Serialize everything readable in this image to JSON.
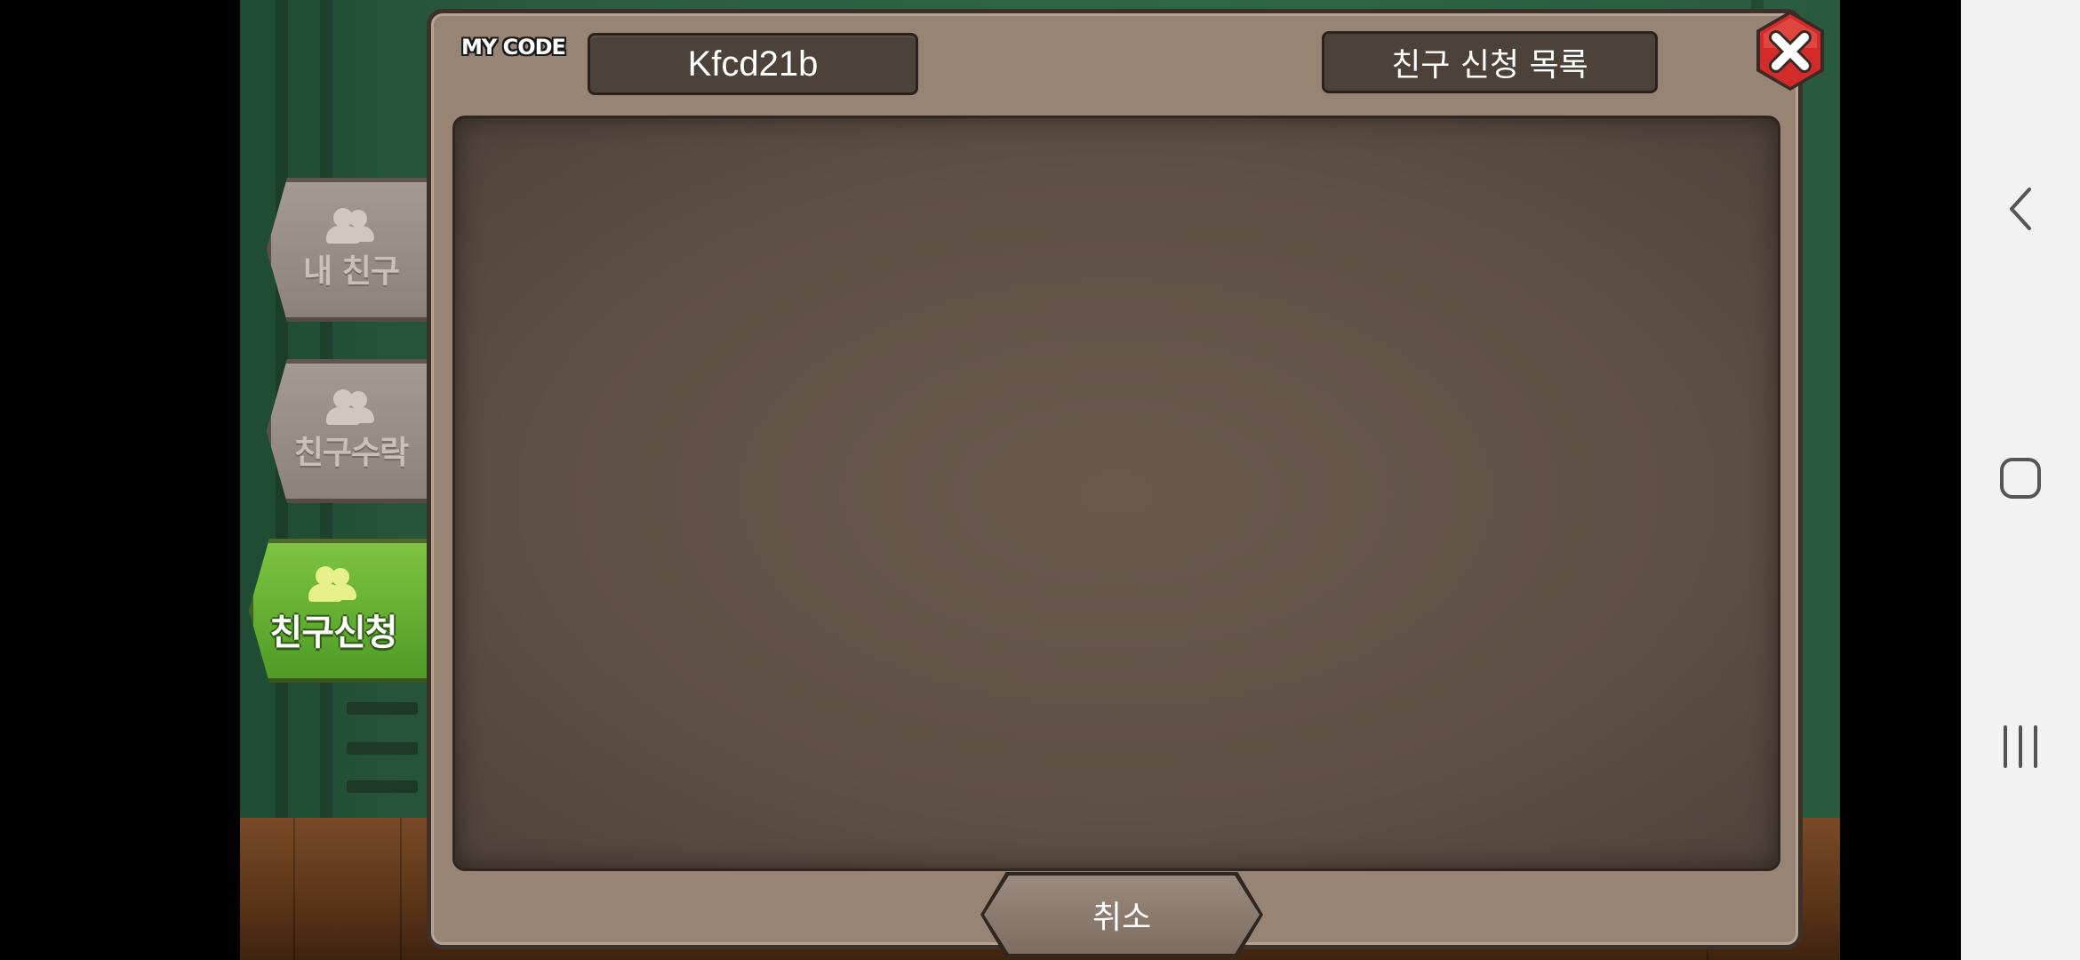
{
  "dialog": {
    "my_code_label": "MY CODE",
    "my_code_value": "Kfcd21b",
    "request_list_button": "친구 신청 목록",
    "cancel_button": "취소"
  },
  "side_tabs": [
    {
      "label": "내 친구",
      "active": false,
      "icon": "friends-icon"
    },
    {
      "label": "친구수락",
      "active": false,
      "icon": "friends-icon"
    },
    {
      "label": "친구신청",
      "active": true,
      "icon": "friends-icon"
    }
  ],
  "colors": {
    "panel": "#978475",
    "list_area": "#5f5045",
    "active_tab": "#5aa82e",
    "inactive_tab": "#9a8f86",
    "close_button": "#d32a2a"
  },
  "system_nav": {
    "back_icon": "back-chevron-icon",
    "home_icon": "home-icon",
    "recents_icon": "recents-icon"
  }
}
